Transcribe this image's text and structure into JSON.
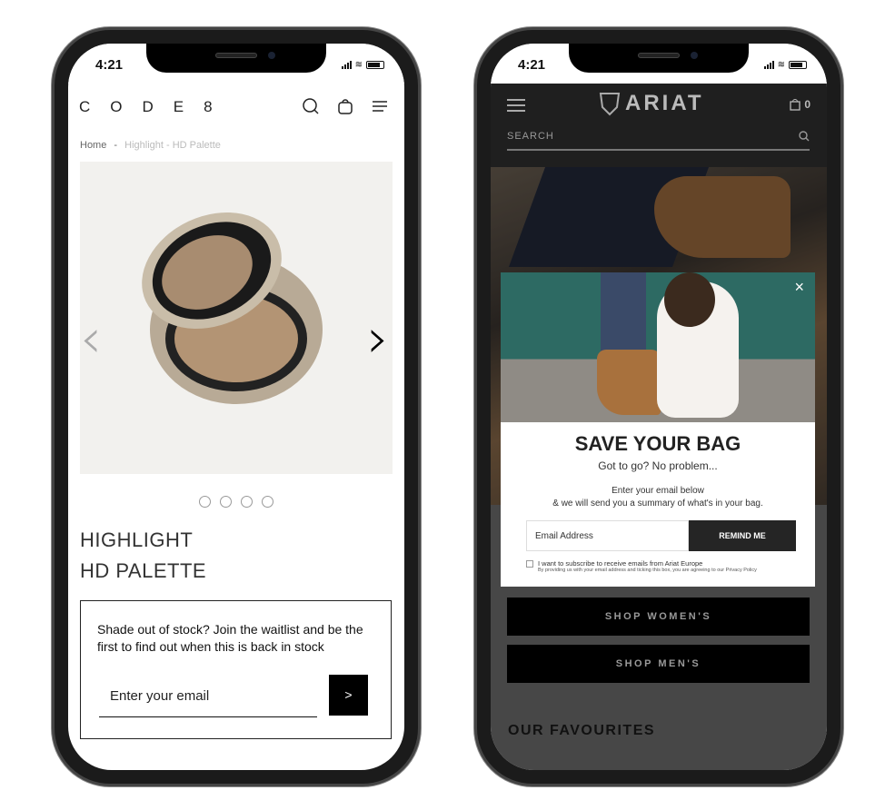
{
  "left_phone": {
    "time": "4:21",
    "brand": "CODE8",
    "breadcrumb": {
      "home": "Home",
      "separator": "-",
      "current": "Highlight - HD Palette"
    },
    "product": {
      "title_line1": "HIGHLIGHT",
      "title_line2": "HD PALETTE",
      "carousel_dots": 4,
      "prev_arrow": "‹",
      "next_arrow": "›"
    },
    "waitlist": {
      "message": "Shade out of stock? Join the waitlist and be the first to find out when this is back in stock",
      "email_placeholder": "Enter your email",
      "submit_label": ">"
    }
  },
  "right_phone": {
    "time": "4:21",
    "brand": "ARIAT",
    "bag_count": "0",
    "search_placeholder": "SEARCH",
    "modal": {
      "close": "×",
      "title": "SAVE YOUR BAG",
      "subtitle": "Got to go? No problem...",
      "desc_line1": "Enter your email below",
      "desc_line2": "& we will send you a summary of what's in your bag.",
      "email_placeholder": "Email Address",
      "button": "REMIND ME",
      "checkbox_label": "I want to subscribe to receive emails from Ariat Europe",
      "checkbox_note": "By providing us with your email address and ticking this box, you are agreeing to our Privacy Policy"
    },
    "buttons": {
      "women": "SHOP WOMEN'S",
      "men": "SHOP MEN'S"
    },
    "section_title": "OUR FAVOURITES"
  }
}
